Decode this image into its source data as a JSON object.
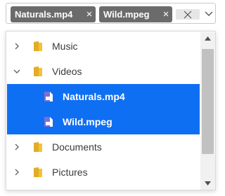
{
  "chips": [
    {
      "label": "Naturals.mp4",
      "remove": "×"
    },
    {
      "label": "Wild.mpeg",
      "remove": "×"
    }
  ],
  "clear_glyph": "✕",
  "tree": [
    {
      "label": "Music",
      "expander": "chevron-right",
      "icon": "folder-icon",
      "level": 1,
      "selected": false
    },
    {
      "label": "Videos",
      "expander": "chevron-down",
      "icon": "folder-icon",
      "level": 1,
      "selected": false
    },
    {
      "label": "Naturals.mp4",
      "icon": "video-file-icon",
      "level": 2,
      "selected": true
    },
    {
      "label": "Wild.mpeg",
      "icon": "video-file-icon",
      "level": 2,
      "selected": true
    },
    {
      "label": "Documents",
      "expander": "chevron-right",
      "icon": "folder-icon",
      "level": 1,
      "selected": false
    },
    {
      "label": "Pictures",
      "expander": "chevron-right",
      "icon": "folder-icon",
      "level": 1,
      "selected": false
    }
  ],
  "colors": {
    "chip_bg": "#6b6b6b",
    "selection": "#0f6ff2",
    "folder": "#f3c13a",
    "video_icon": "#7b6fd8"
  }
}
